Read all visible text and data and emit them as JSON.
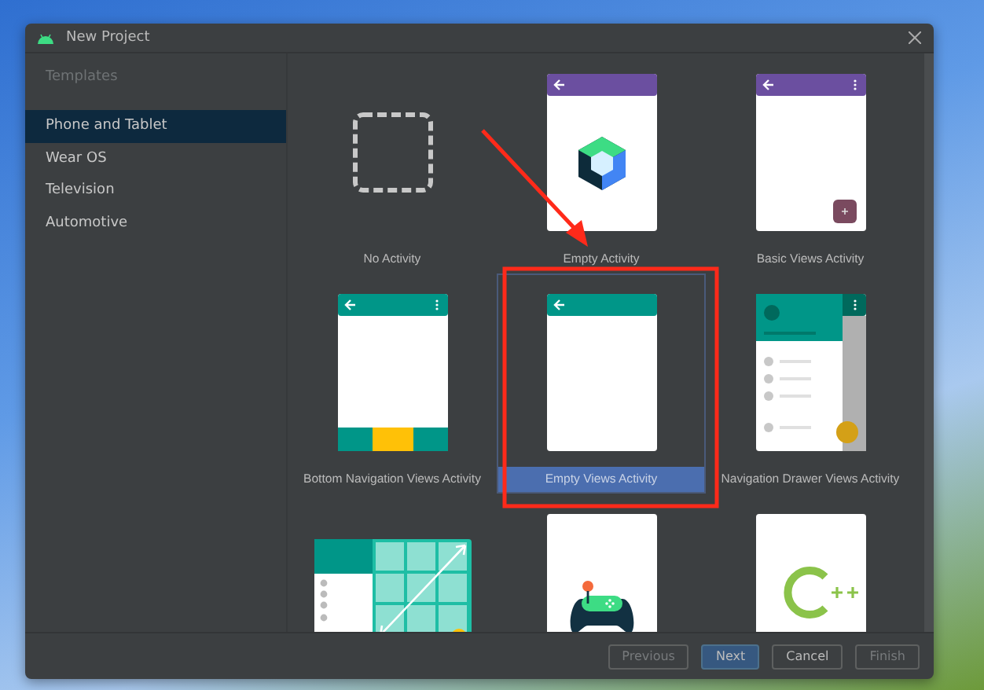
{
  "window": {
    "title": "New Project"
  },
  "sidebar": {
    "heading": "Templates",
    "items": [
      {
        "label": "Phone and Tablet",
        "selected": true
      },
      {
        "label": "Wear OS",
        "selected": false
      },
      {
        "label": "Television",
        "selected": false
      },
      {
        "label": "Automotive",
        "selected": false
      }
    ]
  },
  "templates": [
    {
      "kind": "no-activity",
      "label": "No Activity",
      "selected": false
    },
    {
      "kind": "empty-compose",
      "label": "Empty Activity",
      "selected": false
    },
    {
      "kind": "basic",
      "label": "Basic Views Activity",
      "selected": false
    },
    {
      "kind": "bottom-nav",
      "label": "Bottom Navigation Views Activity",
      "selected": false
    },
    {
      "kind": "empty-views",
      "label": "Empty Views Activity",
      "selected": true
    },
    {
      "kind": "nav-drawer",
      "label": "Navigation Drawer Views Activity",
      "selected": false
    },
    {
      "kind": "responsive",
      "selected": false
    },
    {
      "kind": "game",
      "selected": false
    },
    {
      "kind": "cpp",
      "selected": false
    }
  ],
  "footer": {
    "buttons": [
      {
        "label": "Previous",
        "primary": false,
        "disabled": true
      },
      {
        "label": "Next",
        "primary": true,
        "disabled": false
      },
      {
        "label": "Cancel",
        "primary": false,
        "disabled": false
      },
      {
        "label": "Finish",
        "primary": false,
        "disabled": true
      }
    ]
  },
  "annotations": {
    "arrow": true,
    "highlight_box": true
  }
}
